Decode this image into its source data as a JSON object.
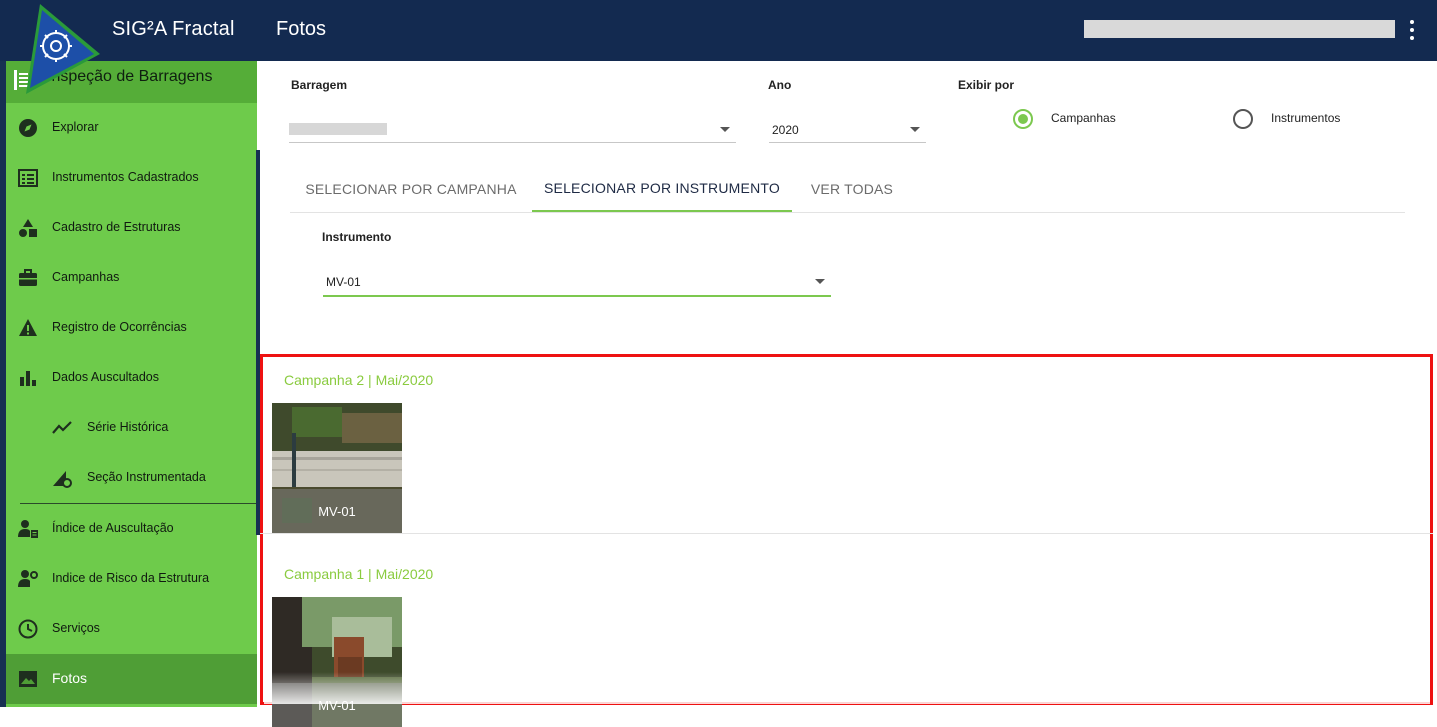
{
  "header": {
    "app_title": "SIG²A Fractal",
    "page_title": "Fotos",
    "menu_icon": "more-vert-icon"
  },
  "sidebar": {
    "module_title": "Inspeção de Barragens",
    "items": [
      {
        "label": "Explorar",
        "icon": "compass-icon"
      },
      {
        "label": "Instrumentos Cadastrados",
        "icon": "list-icon"
      },
      {
        "label": "Cadastro de Estruturas",
        "icon": "shapes-icon"
      },
      {
        "label": "Campanhas",
        "icon": "briefcase-icon"
      },
      {
        "label": "Registro de Ocorrências",
        "icon": "warning-icon"
      },
      {
        "label": "Dados Auscultados",
        "icon": "bar-chart-icon"
      },
      {
        "label": "Série Histórica",
        "icon": "trend-line-icon"
      },
      {
        "label": "Seção Instrumentada",
        "icon": "section-gear-icon"
      },
      {
        "label": "Índice de Auscultação",
        "icon": "user-list-icon"
      },
      {
        "label": "Indice de Risco da Estrutura",
        "icon": "user-settings-icon"
      },
      {
        "label": "Serviços",
        "icon": "clock-icon"
      },
      {
        "label": "Fotos",
        "icon": "image-icon",
        "active": true
      }
    ]
  },
  "filters": {
    "barragem_label": "Barragem",
    "ano_label": "Ano",
    "ano_value": "2020",
    "exibir_label": "Exibir por",
    "radio_campanhas": "Campanhas",
    "radio_instrumentos": "Instrumentos",
    "selected": "Campanhas"
  },
  "tabs": [
    {
      "label": "SELECIONAR POR CAMPANHA",
      "active": false
    },
    {
      "label": "SELECIONAR POR INSTRUMENTO",
      "active": true
    },
    {
      "label": "VER TODAS",
      "active": false
    }
  ],
  "instrument": {
    "label": "Instrumento",
    "value": "MV-01"
  },
  "campaigns": [
    {
      "title": "Campanha 2 | Mai/2020",
      "photos": [
        {
          "caption": "MV-01"
        }
      ]
    },
    {
      "title": "Campanha 1 | Mai/2020",
      "photos": [
        {
          "caption": "MV-01"
        }
      ]
    }
  ],
  "colors": {
    "topbar": "#132a50",
    "sidebar": "#6ecb4b",
    "sidebar_active": "#4f9e36",
    "accent": "#7cc84f",
    "highlight_border": "#ee1111"
  }
}
